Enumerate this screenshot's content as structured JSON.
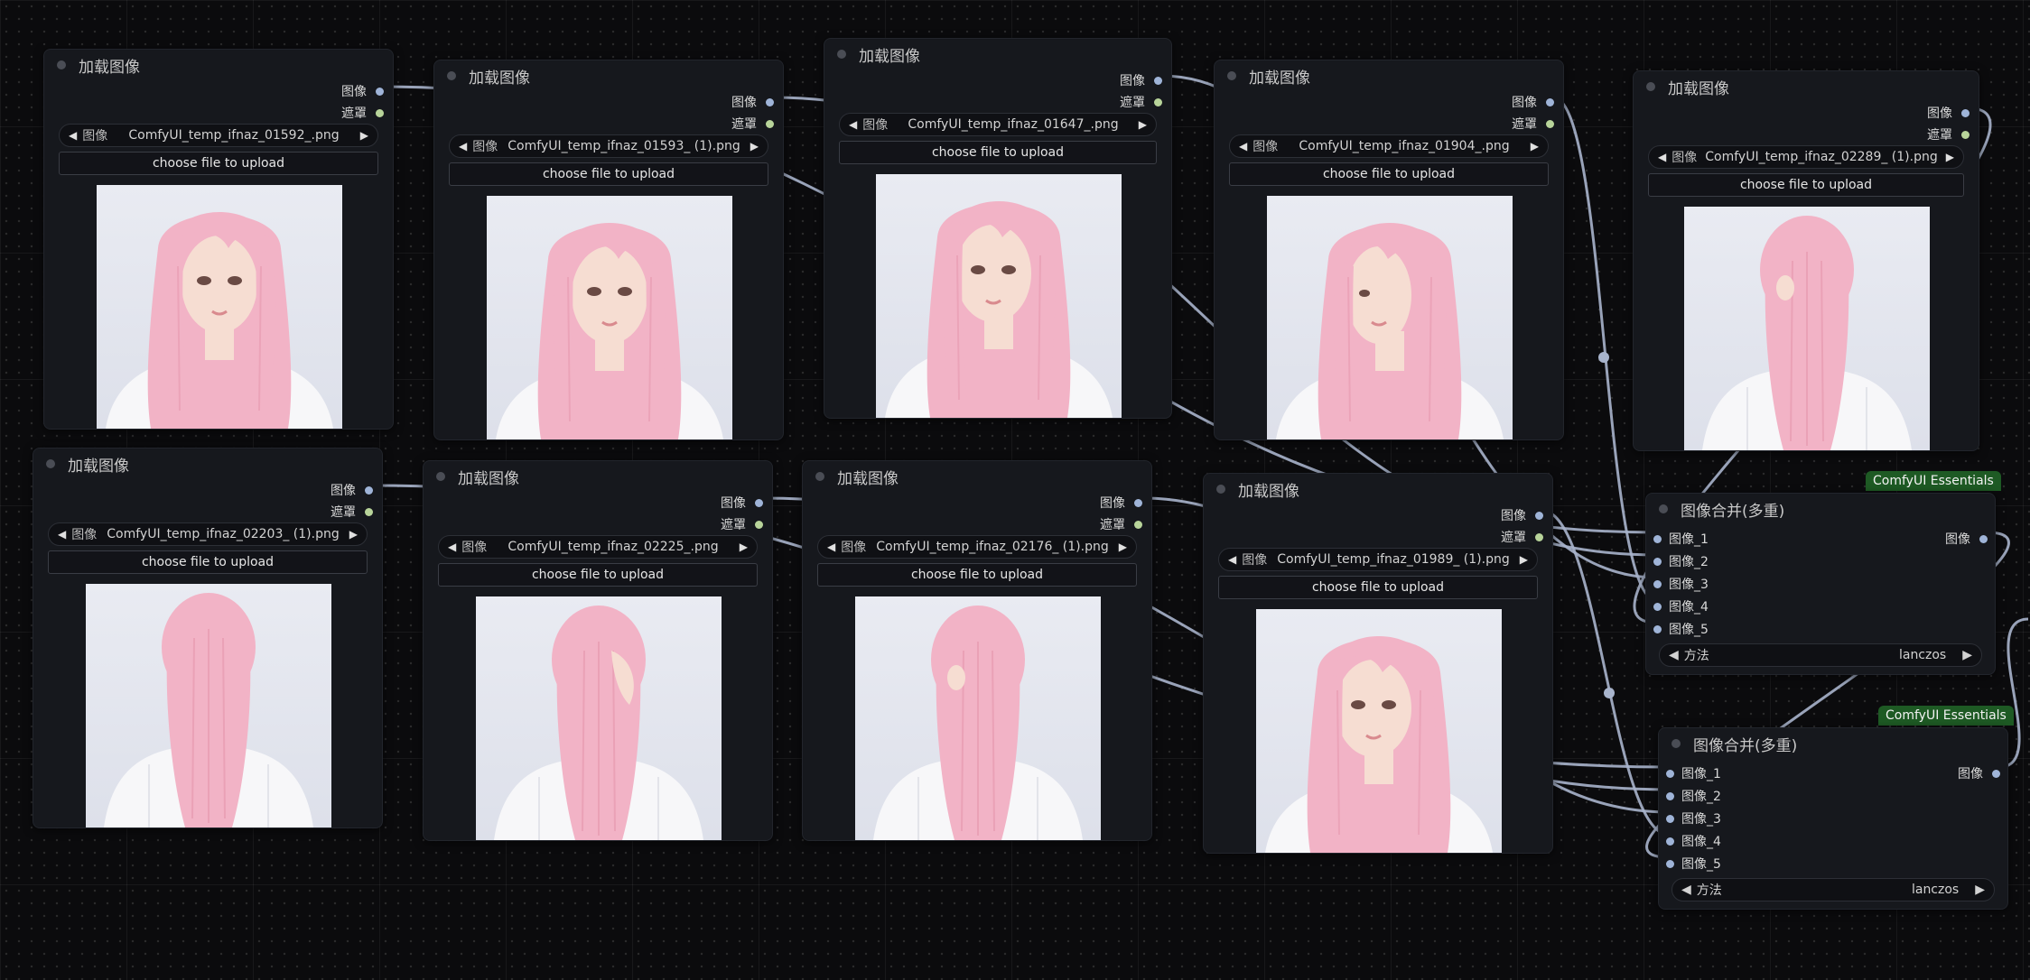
{
  "app": "ComfyUI",
  "load_nodes": [
    {
      "title": "加载图像",
      "out_image": "图像",
      "out_mask": "遮罩",
      "field_label": "图像",
      "filename": "ComfyUI_temp_ifnaz_01592_.png",
      "upload_label": "choose file to upload",
      "view": "front"
    },
    {
      "title": "加载图像",
      "out_image": "图像",
      "out_mask": "遮罩",
      "field_label": "图像",
      "filename": "ComfyUI_temp_ifnaz_01593_ (1).png",
      "upload_label": "choose file to upload",
      "view": "front"
    },
    {
      "title": "加载图像",
      "out_image": "图像",
      "out_mask": "遮罩",
      "field_label": "图像",
      "filename": "ComfyUI_temp_ifnaz_01647_.png",
      "upload_label": "choose file to upload",
      "view": "three-quarter"
    },
    {
      "title": "加载图像",
      "out_image": "图像",
      "out_mask": "遮罩",
      "field_label": "图像",
      "filename": "ComfyUI_temp_ifnaz_01904_.png",
      "upload_label": "choose file to upload",
      "view": "side"
    },
    {
      "title": "加载图像",
      "out_image": "图像",
      "out_mask": "遮罩",
      "field_label": "图像",
      "filename": "ComfyUI_temp_ifnaz_02289_ (1).png",
      "upload_label": "choose file to upload",
      "view": "back-side"
    },
    {
      "title": "加载图像",
      "out_image": "图像",
      "out_mask": "遮罩",
      "field_label": "图像",
      "filename": "ComfyUI_temp_ifnaz_02203_ (1).png",
      "upload_label": "choose file to upload",
      "view": "back"
    },
    {
      "title": "加载图像",
      "out_image": "图像",
      "out_mask": "遮罩",
      "field_label": "图像",
      "filename": "ComfyUI_temp_ifnaz_02225_.png",
      "upload_label": "choose file to upload",
      "view": "back-three-quarter"
    },
    {
      "title": "加载图像",
      "out_image": "图像",
      "out_mask": "遮罩",
      "field_label": "图像",
      "filename": "ComfyUI_temp_ifnaz_02176_ (1).png",
      "upload_label": "choose file to upload",
      "view": "back-side"
    },
    {
      "title": "加载图像",
      "out_image": "图像",
      "out_mask": "遮罩",
      "field_label": "图像",
      "filename": "ComfyUI_temp_ifnaz_01989_ (1).png",
      "upload_label": "choose file to upload",
      "view": "three-quarter"
    }
  ],
  "merge_nodes": [
    {
      "badge": "ComfyUI Essentials",
      "title": "图像合并(多重)",
      "inputs": [
        "图像_1",
        "图像_2",
        "图像_3",
        "图像_4",
        "图像_5"
      ],
      "output": "图像",
      "method_label": "方法",
      "method_value": "lanczos"
    },
    {
      "badge": "ComfyUI Essentials",
      "title": "图像合并(多重)",
      "inputs": [
        "图像_1",
        "图像_2",
        "图像_3",
        "图像_4",
        "图像_5"
      ],
      "output": "图像",
      "method_label": "方法",
      "method_value": "lanczos"
    }
  ],
  "colors": {
    "background": "#0b0b0d",
    "node_bg": "#16181d",
    "image_socket": "#9fb4d8",
    "mask_socket": "#b8d49a",
    "wire": "#a8b4cc",
    "badge": "#1e5a24",
    "hair": "#f2b3c6",
    "shirt": "#f7f7f9"
  }
}
